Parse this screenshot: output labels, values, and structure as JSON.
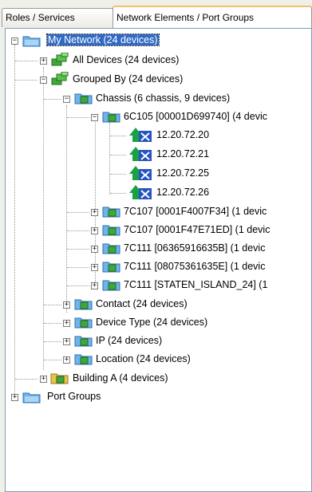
{
  "tabs": [
    {
      "label": "Roles / Services",
      "active": false
    },
    {
      "label": "Network Elements / Port Groups",
      "active": true
    }
  ],
  "tree": {
    "root": "My Network (24 devices)",
    "all_devices": "All Devices (24 devices)",
    "grouped_by": "Grouped By (24 devices)",
    "chassis": "Chassis (6 chassis, 9 devices)",
    "chassis_item_1": "6C105 [00001D699740] (4 devic",
    "ips": [
      "12.20.72.20",
      "12.20.72.21",
      "12.20.72.25",
      "12.20.72.26"
    ],
    "chassis_items": [
      "7C107 [0001F4007F34] (1 devic",
      "7C107 [0001F47E71ED] (1 devic",
      "7C111 [06365916635B] (1 devic",
      "7C111 [08075361635E] (1 devic",
      "7C111 [STATEN_ISLAND_24] (1"
    ],
    "contact": "Contact (24 devices)",
    "device_type": "Device Type (24 devices)",
    "ip": "IP (24 devices)",
    "location": "Location (24 devices)",
    "building": "Building A (4 devices)",
    "port_groups": "Port Groups"
  },
  "colors": {
    "selection": "#316ac5",
    "folder": "#6fb4ea",
    "network_group": "#3fa83a",
    "device_green": "#1aa146",
    "device_blue": "#2653c4"
  },
  "icons": [
    "expand-box-icon",
    "collapse-box-icon",
    "network-folder-icon",
    "network-group-icon",
    "group-folder-icon",
    "device-icon",
    "building-folder-icon",
    "folder-icon"
  ]
}
